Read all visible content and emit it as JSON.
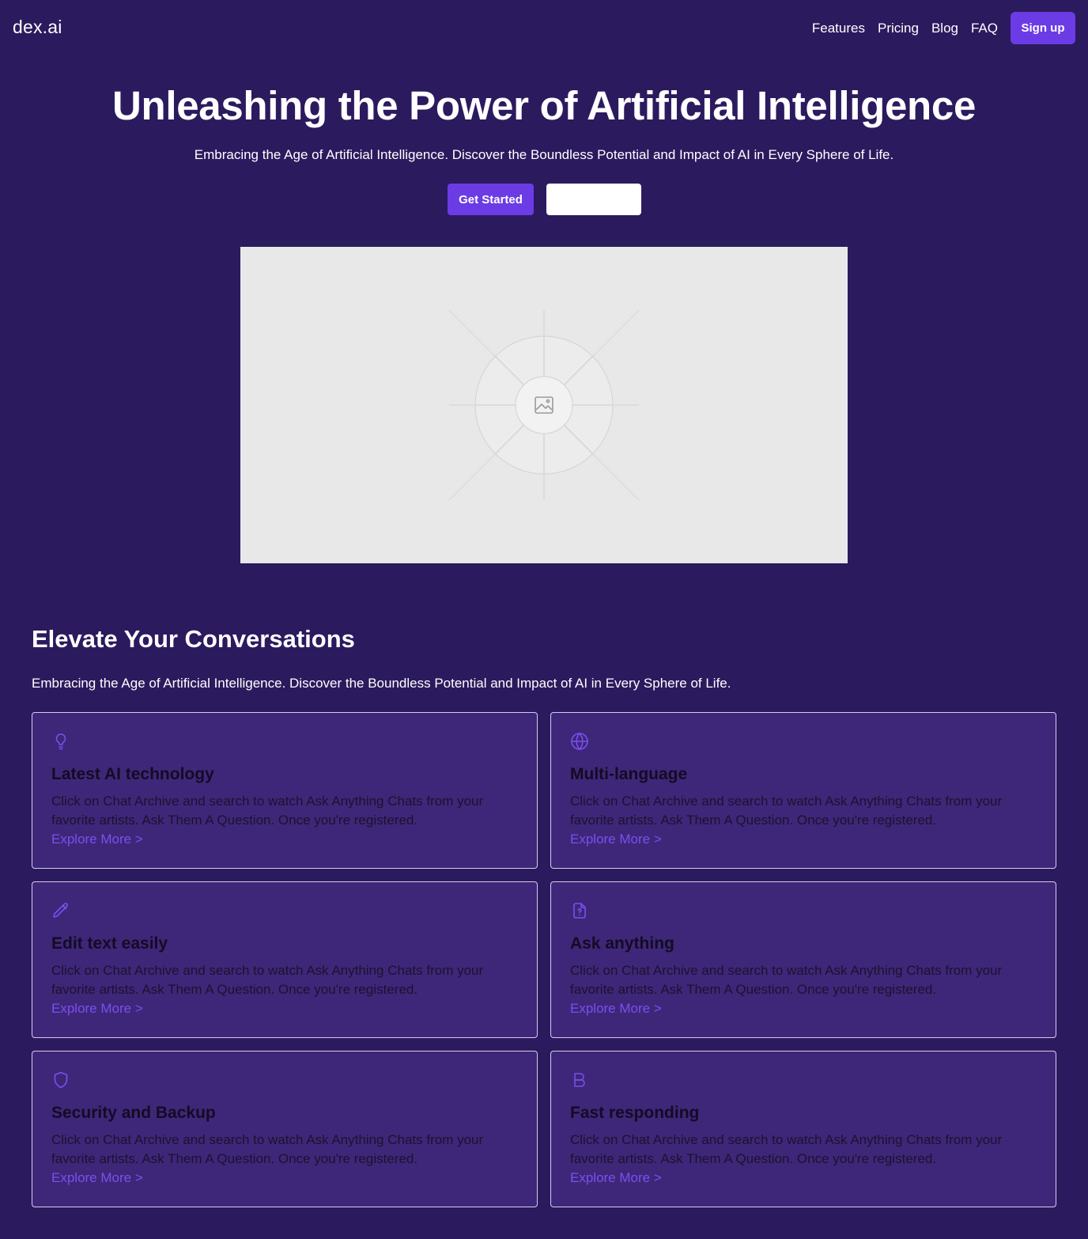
{
  "header": {
    "logo": "dex.ai",
    "nav": [
      "Features",
      "Pricing",
      "Blog",
      "FAQ"
    ],
    "signup_label": "Sign up"
  },
  "hero": {
    "title": "Unleashing the Power of Artificial Intelligence",
    "subtitle": "Embracing the Age of Artificial Intelligence. Discover the Boundless Potential and Impact of AI in Every Sphere of Life.",
    "primary_button": "Get Started",
    "secondary_button": ""
  },
  "features": {
    "title": "Elevate Your Conversations",
    "subtitle": "Embracing the Age of Artificial Intelligence. Discover the Boundless Potential and Impact of AI in Every Sphere of Life.",
    "cards": [
      {
        "icon": "lightbulb-icon",
        "title": "Latest AI technology",
        "text": "Click on Chat Archive and search to watch Ask Anything Chats from your favorite artists. Ask Them A Question. Once you're registered.",
        "link": "Explore More >"
      },
      {
        "icon": "globe-icon",
        "title": "Multi-language",
        "text": "Click on Chat Archive and search to watch Ask Anything Chats from your favorite artists. Ask Them A Question. Once you're registered.",
        "link": "Explore More >"
      },
      {
        "icon": "pencil-icon",
        "title": "Edit text easily",
        "text": "Click on Chat Archive and search to watch Ask Anything Chats from your favorite artists. Ask Them A Question. Once you're registered.",
        "link": "Explore More >"
      },
      {
        "icon": "file-question-icon",
        "title": "Ask anything",
        "text": "Click on Chat Archive and search to watch Ask Anything Chats from your favorite artists. Ask Them A Question. Once you're registered.",
        "link": "Explore More >"
      },
      {
        "icon": "shield-icon",
        "title": "Security and Backup",
        "text": "Click on Chat Archive and search to watch Ask Anything Chats from your favorite artists. Ask Them A Question. Once you're registered.",
        "link": "Explore More >"
      },
      {
        "icon": "bold-icon",
        "title": "Fast responding",
        "text": "Click on Chat Archive and search to watch Ask Anything Chats from your favorite artists. Ask Them A Question. Once you're registered.",
        "link": "Explore More >"
      }
    ]
  },
  "colors": {
    "background": "#2c1a5e",
    "accent": "#6b3be6",
    "card_bg": "#3e2778",
    "link": "#7b4ef0"
  }
}
